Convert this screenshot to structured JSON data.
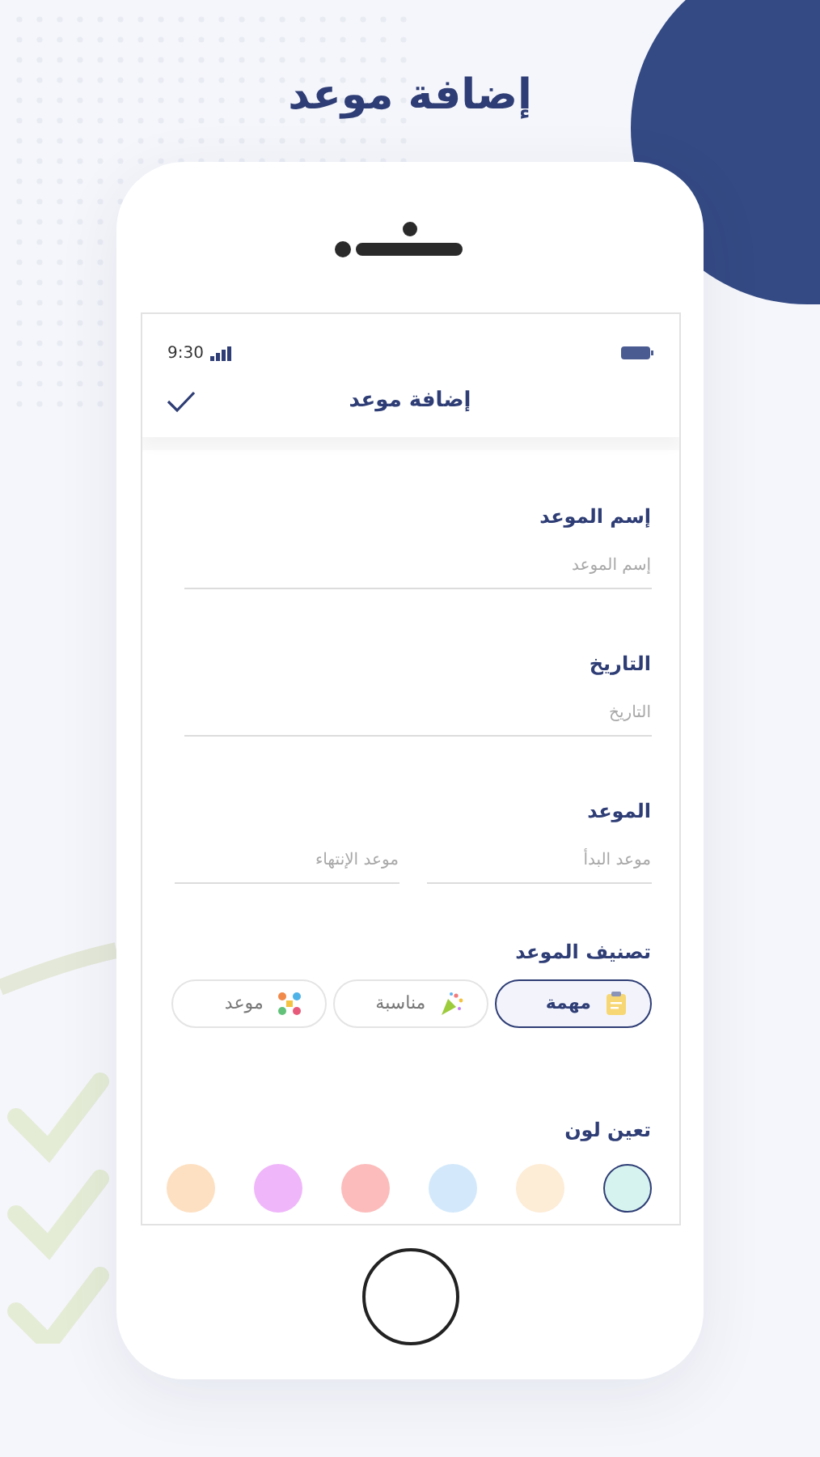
{
  "headline": "إضافة موعد",
  "status_bar": {
    "time": "9:30"
  },
  "header": {
    "title": "إضافة موعد"
  },
  "sections": [
    {
      "kind": "single",
      "label": "إسم الموعد",
      "fields": [
        {
          "placeholder": "إسم الموعد"
        }
      ]
    },
    {
      "kind": "single",
      "label": "التاريخ",
      "fields": [
        {
          "placeholder": "التاريخ"
        }
      ]
    },
    {
      "kind": "pair",
      "label": "الموعد",
      "fields": [
        {
          "placeholder": "موعد البدأ"
        },
        {
          "placeholder": "موعد الإنتهاء"
        }
      ]
    }
  ],
  "category": {
    "label": "تصنيف الموعد",
    "options": [
      {
        "label": "مهمة",
        "kind": "task",
        "selected": true
      },
      {
        "label": "مناسبة",
        "kind": "party",
        "selected": false
      },
      {
        "label": "موعد",
        "kind": "meeting",
        "selected": false
      }
    ]
  },
  "color_picker": {
    "label": "تعين لون",
    "colors": [
      {
        "color": "#d6f3ef",
        "selected": true
      },
      {
        "color": "#fdecd6",
        "selected": false
      },
      {
        "color": "#d3e9fb",
        "selected": false
      },
      {
        "color": "#fcbcbc",
        "selected": false
      },
      {
        "color": "#efb7fa",
        "selected": false
      },
      {
        "color": "#fde0c2",
        "selected": false
      }
    ]
  }
}
